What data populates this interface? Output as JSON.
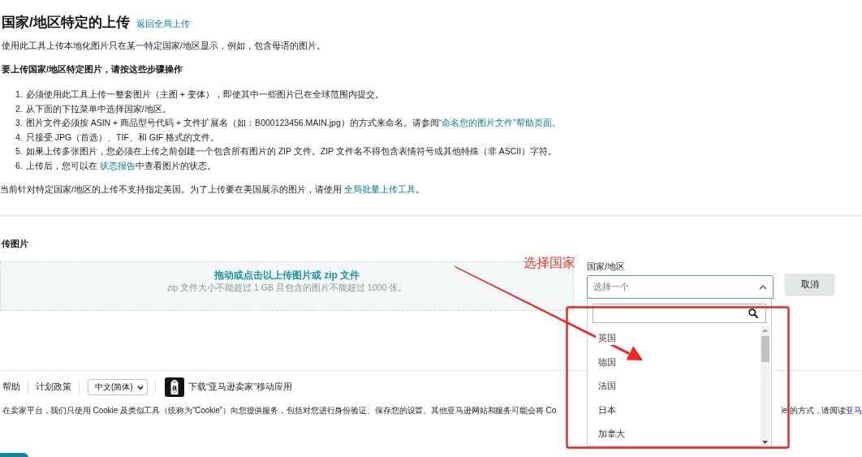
{
  "header": {
    "title": "国家/地区特定的上传",
    "back_link": "返回全局上传"
  },
  "description": "使用此工具上传本地化图片只在某一特定国家/地区显示，例如，包含母语的图片。",
  "steps_heading": "要上传国家/地区特定图片，请按这些步骤操作",
  "steps": [
    {
      "number": "1.",
      "segments": [
        {
          "kind": "text",
          "text": "必须使用此工具上传一整套图片（主图 + 变体），即使其中一些图片已在全球范围内提交。"
        }
      ]
    },
    {
      "number": "2.",
      "segments": [
        {
          "kind": "text",
          "text": "从下面的下拉菜单中选择国家/地区。"
        }
      ]
    },
    {
      "number": "3.",
      "segments": [
        {
          "kind": "text",
          "text": "图片文件必须按 ASIN + 商品型号代码 + 文件扩展名（如：B000123456.MAIN.jpg）的方式来命名。请参阅"
        },
        {
          "kind": "link",
          "text": "“命名您的图片文件”帮助页面。"
        }
      ]
    },
    {
      "number": "4.",
      "segments": [
        {
          "kind": "text",
          "text": "只接受 JPG（首选）、TIF、和 GIF 格式的文件。"
        }
      ]
    },
    {
      "number": "5.",
      "segments": [
        {
          "kind": "text",
          "text": "如果上传多张图片，您必须在上传之前创建一个包含所有图片的 ZIP 文件。ZIP 文件名不得包含表情符号或其他特殊（非 ASCII）字符。"
        }
      ]
    },
    {
      "number": "6.",
      "segments": [
        {
          "kind": "text",
          "text": "上传后，您可以在 "
        },
        {
          "kind": "link",
          "text": "状态报告"
        },
        {
          "kind": "text",
          "text": "中查看图片的状态。"
        }
      ]
    }
  ],
  "note": {
    "segments": [
      {
        "kind": "text",
        "text": "当前针对特定国家/地区的上传不支持指定美国。为了上传要在美国展示的图片，请使用 "
      },
      {
        "kind": "link",
        "text": "全局批量上传工具"
      },
      {
        "kind": "text",
        "text": "。"
      }
    ]
  },
  "upload": {
    "section_title": "传图片",
    "drop_title": "拖动或点击以上传图片或 zip 文件",
    "drop_hint": "zip 文件大小不能超过 1 GB 且包含的图片不能超过 1000 张。"
  },
  "country": {
    "label": "国家/地区",
    "placeholder": "选择一个",
    "expanded": true,
    "options": [
      "英国",
      "德国",
      "法国",
      "日本",
      "加拿大"
    ]
  },
  "cancel_button": "取消",
  "footer": {
    "links": [
      "帮助",
      "计划政策"
    ],
    "language": "中文(简体)",
    "app_icon_letter": "a",
    "app_link": "下载“亚马逊卖家”移动应用",
    "cookie_text_left": "在卖家平台，我们只使用 Cookie 及类似工具（统称为“Cookie”）向您提供服务，包括对您进行身份验证、保存您的设置。其他亚马逊网站和服务可能会将 Co",
    "cookie_text_right": "ie 的方式，请阅读",
    "cookie_link": "亚马"
  },
  "annotation": {
    "label": "选择国家"
  }
}
